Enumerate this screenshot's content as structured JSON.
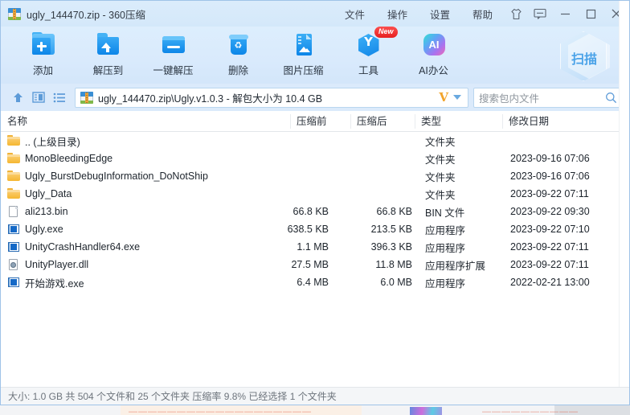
{
  "window": {
    "title": "ugly_144470.zip - 360压缩",
    "app_icon": "archive-zip-icon"
  },
  "menu": {
    "items": [
      {
        "label": "文件",
        "name": "menu-file"
      },
      {
        "label": "操作",
        "name": "menu-action"
      },
      {
        "label": "设置",
        "name": "menu-settings"
      },
      {
        "label": "帮助",
        "name": "menu-help"
      }
    ],
    "icons": [
      {
        "name": "skin-icon"
      },
      {
        "name": "feedback-icon"
      }
    ],
    "controls": {
      "minimize": "—",
      "maximize": "□",
      "close": "✕"
    }
  },
  "toolbar": {
    "buttons": [
      {
        "label": "添加",
        "icon": "folder-add-icon"
      },
      {
        "label": "解压到",
        "icon": "folder-extract-icon"
      },
      {
        "label": "一键解压",
        "icon": "one-click-extract-icon"
      },
      {
        "label": "删除",
        "icon": "trash-icon"
      },
      {
        "label": "图片压缩",
        "icon": "image-compress-icon"
      },
      {
        "label": "工具",
        "icon": "tools-hex-icon",
        "badge": "New"
      },
      {
        "label": "AI办公",
        "icon": "ai-icon",
        "icon_text": "AI"
      }
    ],
    "scan": {
      "label": "扫描",
      "icon": "scan-hex-icon"
    }
  },
  "addressbar": {
    "up_icon": "up-arrow-icon",
    "preview_icon": "preview-pane-icon",
    "list_icon": "list-view-icon",
    "path": "ugly_144470.zip\\Ugly.v1.0.3 - 解包大小为 10.4 GB",
    "path_icon": "archive-zip-icon",
    "vip_logo": "V",
    "dropdown_icon": "chevron-down-icon",
    "search_placeholder": "搜索包内文件",
    "search_value": "",
    "search_icon": "search-icon"
  },
  "list": {
    "columns": [
      {
        "key": "name",
        "label": "名称"
      },
      {
        "key": "pre",
        "label": "压缩前"
      },
      {
        "key": "post",
        "label": "压缩后"
      },
      {
        "key": "type",
        "label": "类型"
      },
      {
        "key": "date",
        "label": "修改日期"
      }
    ],
    "rows": [
      {
        "icon": "folder-icon",
        "name": ".. (上级目录)",
        "pre": "",
        "post": "",
        "type": "文件夹",
        "date": ""
      },
      {
        "icon": "folder-icon",
        "name": "MonoBleedingEdge",
        "pre": "",
        "post": "",
        "type": "文件夹",
        "date": "2023-09-16 07:06"
      },
      {
        "icon": "folder-icon",
        "name": "Ugly_BurstDebugInformation_DoNotShip",
        "pre": "",
        "post": "",
        "type": "文件夹",
        "date": "2023-09-16 07:06"
      },
      {
        "icon": "folder-icon",
        "name": "Ugly_Data",
        "pre": "",
        "post": "",
        "type": "文件夹",
        "date": "2023-09-22 07:11"
      },
      {
        "icon": "file-icon",
        "name": "ali213.bin",
        "pre": "66.8 KB",
        "post": "66.8 KB",
        "type": "BIN 文件",
        "date": "2023-09-22 09:30"
      },
      {
        "icon": "exe-icon",
        "name": "Ugly.exe",
        "pre": "638.5 KB",
        "post": "213.5 KB",
        "type": "应用程序",
        "date": "2023-09-22 07:10"
      },
      {
        "icon": "exe-icon",
        "name": "UnityCrashHandler64.exe",
        "pre": "1.1 MB",
        "post": "396.3 KB",
        "type": "应用程序",
        "date": "2023-09-22 07:11"
      },
      {
        "icon": "dll-icon",
        "name": "UnityPlayer.dll",
        "pre": "27.5 MB",
        "post": "11.8 MB",
        "type": "应用程序扩展",
        "date": "2023-09-22 07:11"
      },
      {
        "icon": "exe-icon",
        "name": "开始游戏.exe",
        "pre": "6.4 MB",
        "post": "6.0 MB",
        "type": "应用程序",
        "date": "2022-02-21 13:00"
      }
    ]
  },
  "statusbar": {
    "text": "大小: 1.0 GB 共 504 个文件和 25 个文件夹 压缩率 9.8% 已经选择 1 个文件夹"
  },
  "colors": {
    "titlebar": "#d8eafa",
    "toolbar": "#d9eafc",
    "accent_blue": "#1186e8",
    "folder_yellow": "#f5b731",
    "badge_red": "#e72020",
    "vip_orange": "#f2a42b",
    "status_text": "#6d747c"
  }
}
